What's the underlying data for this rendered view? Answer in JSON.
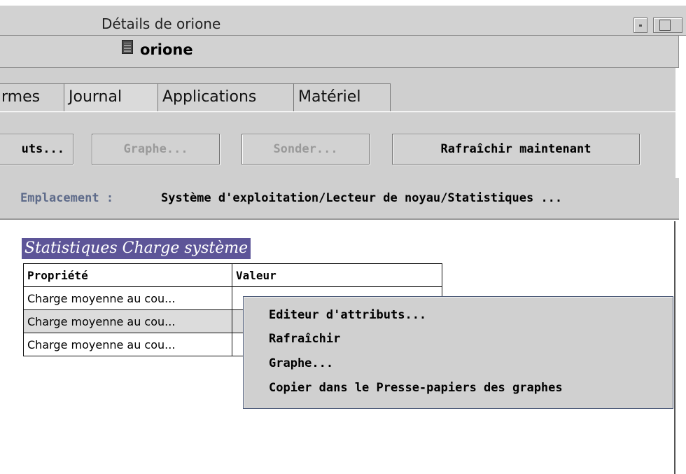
{
  "window": {
    "title": "Détails de orione",
    "host_name": "orione"
  },
  "tabs": [
    {
      "label": "rmes"
    },
    {
      "label": "Journal"
    },
    {
      "label": "Applications"
    },
    {
      "label": "Matériel"
    }
  ],
  "toolbar": {
    "attributes_label": "uts...",
    "graph_label": "Graphe...",
    "probe_label": "Sonder...",
    "refresh_now_label": "Rafraîchir maintenant"
  },
  "location": {
    "label": "Emplacement :",
    "path": "Système d'exploitation/Lecteur de noyau/Statistiques ..."
  },
  "section": {
    "title": "Statistiques Charge système"
  },
  "table": {
    "headers": [
      "Propriété",
      "Valeur"
    ],
    "rows": [
      [
        "Charge moyenne au cou...",
        ""
      ],
      [
        "Charge moyenne au cou...",
        ""
      ],
      [
        "Charge moyenne au cou...",
        ""
      ]
    ]
  },
  "context_menu": {
    "items": [
      {
        "label": "Editeur d'attributs..."
      },
      {
        "label": "Rafraîchir"
      },
      {
        "label": "Graphe..."
      },
      {
        "label": "Copier dans le Presse-papiers des graphes"
      }
    ]
  },
  "colors": {
    "section_title_bg": "#5d5598",
    "location_label": "#5e6b8a",
    "panel_bg": "#cfcfcf"
  }
}
